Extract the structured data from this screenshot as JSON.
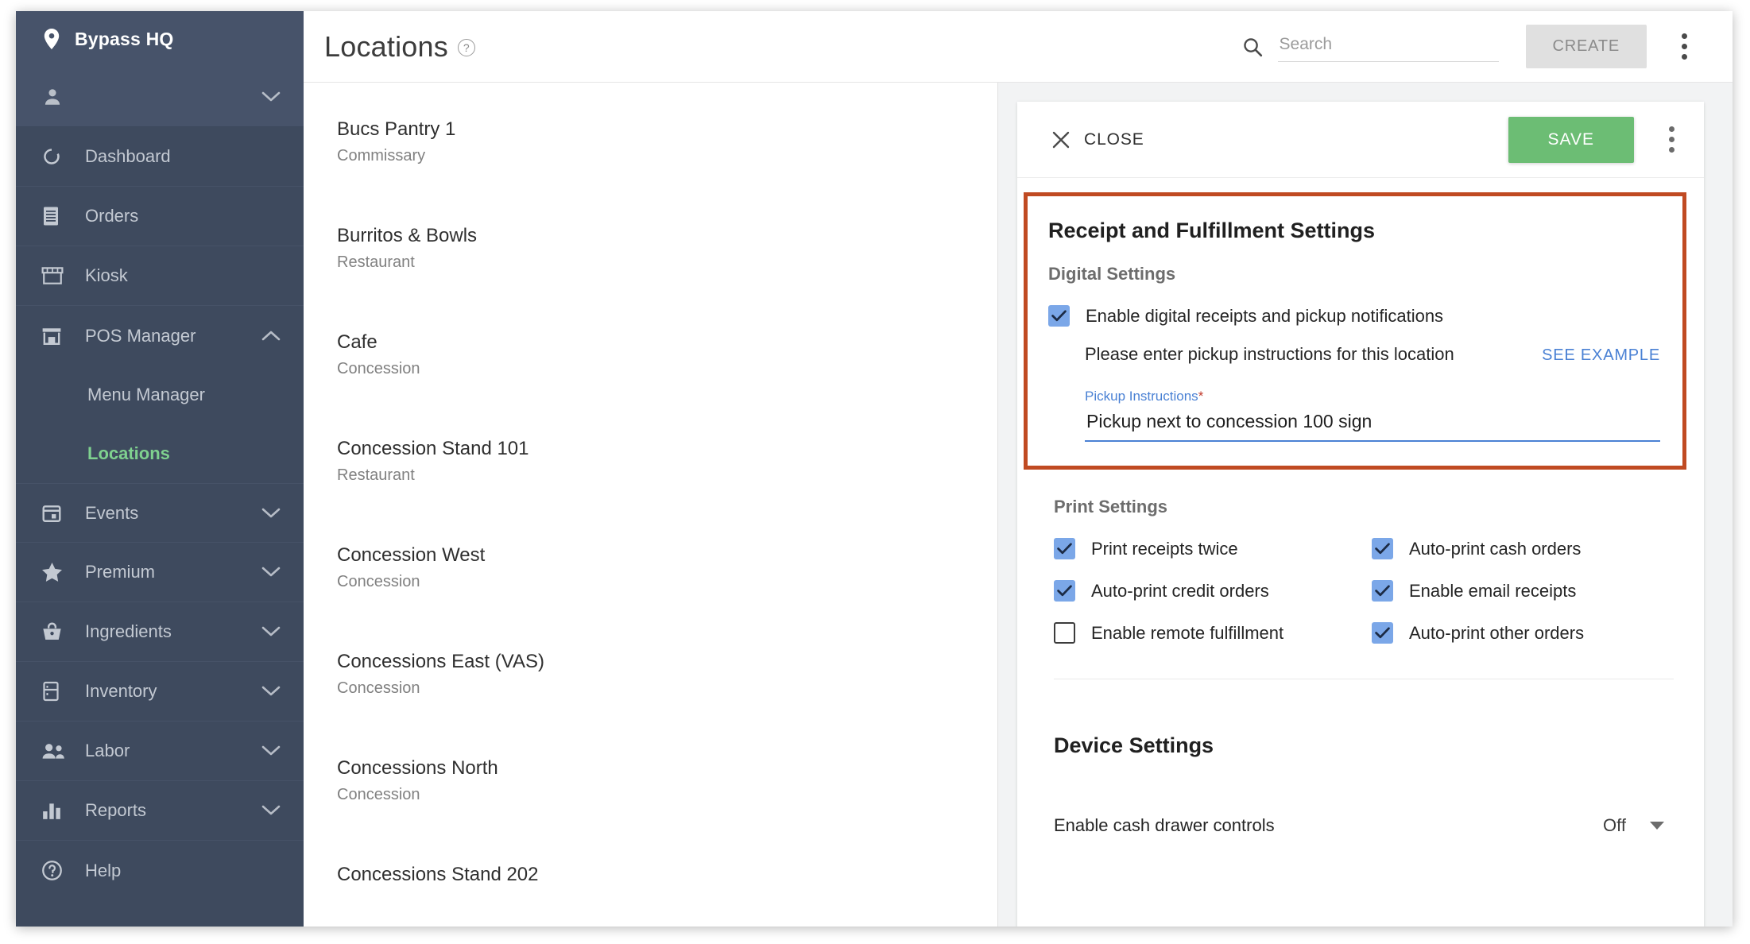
{
  "sidebar": {
    "brand": {
      "name": "Bypass HQ",
      "icon": "map-pin-icon"
    },
    "user": {
      "icon": "person-icon",
      "label": ""
    },
    "items": [
      {
        "label": "Dashboard",
        "icon": "dashboard-icon",
        "expandable": false
      },
      {
        "label": "Orders",
        "icon": "orders-icon",
        "expandable": false
      },
      {
        "label": "Kiosk",
        "icon": "kiosk-icon",
        "expandable": false
      },
      {
        "label": "POS Manager",
        "icon": "pos-manager-icon",
        "expandable": true,
        "expanded": true
      },
      {
        "label": "Events",
        "icon": "calendar-icon",
        "expandable": true
      },
      {
        "label": "Premium",
        "icon": "star-icon",
        "expandable": true
      },
      {
        "label": "Ingredients",
        "icon": "basket-icon",
        "expandable": true
      },
      {
        "label": "Inventory",
        "icon": "inventory-icon",
        "expandable": true
      },
      {
        "label": "Labor",
        "icon": "people-icon",
        "expandable": true
      },
      {
        "label": "Reports",
        "icon": "bar-chart-icon",
        "expandable": true
      },
      {
        "label": "Help",
        "icon": "help-circle-icon",
        "expandable": false
      }
    ],
    "sub_items": [
      {
        "label": "Menu Manager",
        "active": false
      },
      {
        "label": "Locations",
        "active": true
      }
    ],
    "active_color": "#7fd18f"
  },
  "topbar": {
    "title": "Locations",
    "help_icon": "question-mark-icon",
    "search": {
      "placeholder": "Search",
      "value": "",
      "icon": "search-icon"
    },
    "create_label": "CREATE",
    "overflow_icon": "kebab-menu-icon"
  },
  "locations": [
    {
      "name": "Bucs Pantry 1",
      "type": "Commissary"
    },
    {
      "name": "Burritos & Bowls",
      "type": "Restaurant"
    },
    {
      "name": "Cafe",
      "type": "Concession"
    },
    {
      "name": "Concession Stand 101",
      "type": "Restaurant"
    },
    {
      "name": "Concession West",
      "type": "Concession"
    },
    {
      "name": "Concessions East (VAS)",
      "type": "Concession"
    },
    {
      "name": "Concessions North",
      "type": "Concession"
    },
    {
      "name": "Concessions Stand 202",
      "type": ""
    }
  ],
  "detail": {
    "close_label": "CLOSE",
    "close_icon": "close-x-icon",
    "save_label": "SAVE",
    "overflow_icon": "kebab-menu-icon",
    "receipt": {
      "title": "Receipt and Fulfillment Settings",
      "digital_subtitle": "Digital Settings",
      "enable_digital": {
        "label": "Enable digital receipts and pickup notifications",
        "checked": true
      },
      "pickup_note": "Please enter pickup instructions for this location",
      "see_example_label": "SEE EXAMPLE",
      "pickup_field": {
        "label": "Pickup Instructions",
        "required_mark": "*",
        "value": "Pickup next to concession 100 sign"
      },
      "highlight_color": "#c04a22"
    },
    "print": {
      "subtitle": "Print Settings",
      "options": [
        {
          "label": "Print receipts twice",
          "checked": true
        },
        {
          "label": "Auto-print cash orders",
          "checked": true
        },
        {
          "label": "Auto-print credit orders",
          "checked": true
        },
        {
          "label": "Enable email receipts",
          "checked": true
        },
        {
          "label": "Enable remote fulfillment",
          "checked": false
        },
        {
          "label": "Auto-print other orders",
          "checked": true
        }
      ]
    },
    "device": {
      "title": "Device Settings",
      "cash_drawer": {
        "label": "Enable cash drawer controls",
        "value": "Off",
        "caret_icon": "chevron-down-icon"
      }
    }
  }
}
